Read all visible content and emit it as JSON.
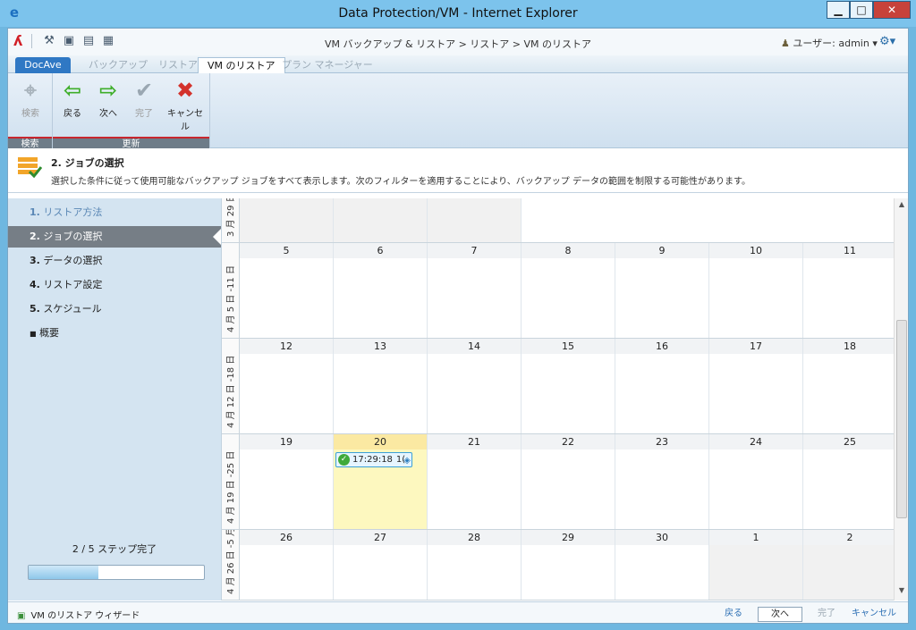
{
  "window": {
    "title": "Data Protection/VM - Internet Explorer"
  },
  "appbar": {
    "breadcrumb": "VM バックアップ & リストア > リストア > VM のリストア",
    "user": "ユーザー: admin ▾"
  },
  "tabs": [
    "DocAve",
    "バックアップ",
    "リストア",
    "VM のリストア",
    "プラン マネージャー"
  ],
  "ribbon": {
    "search_group": "検索",
    "update_group": "更新",
    "search": "検索",
    "back": "戻る",
    "next": "次へ",
    "finish": "完了",
    "cancel": "キャンセル"
  },
  "step_header": {
    "title": "2. ジョブの選択",
    "description": "選択した条件に従って使用可能なバックアップ ジョブをすべて表示します。次のフィルターを適用することにより、バックアップ データの範囲を制限する可能性があります。"
  },
  "steps": [
    {
      "num": "1.",
      "label": "リストア方法"
    },
    {
      "num": "2.",
      "label": "ジョブの選択"
    },
    {
      "num": "3.",
      "label": "データの選択"
    },
    {
      "num": "4.",
      "label": "リストア設定"
    },
    {
      "num": "5.",
      "label": "スケジュール"
    },
    {
      "num": "■",
      "label": "概要"
    }
  ],
  "progress": {
    "label": "2 / 5 ステップ完了",
    "fraction": 0.4
  },
  "calendar": {
    "weeks": [
      {
        "label": "3 月 29 日",
        "days": [
          "",
          "",
          "",
          "",
          "",
          "",
          ""
        ]
      },
      {
        "label": "4 月 5 日 -11 日",
        "days": [
          "5",
          "6",
          "7",
          "8",
          "9",
          "10",
          "11"
        ]
      },
      {
        "label": "4 月 12 日 -18 日",
        "days": [
          "12",
          "13",
          "14",
          "15",
          "16",
          "17",
          "18"
        ]
      },
      {
        "label": "4 月 19 日 -25 日",
        "days": [
          "19",
          "20",
          "21",
          "22",
          "23",
          "24",
          "25"
        ]
      },
      {
        "label": "4 月 26 日 -5 月 2 日",
        "days": [
          "26",
          "27",
          "28",
          "29",
          "30",
          "1",
          "2"
        ]
      }
    ],
    "event": {
      "time": "17:29:18",
      "extra": "1("
    }
  },
  "bottombar": {
    "wizard": "VM のリストア ウィザード",
    "back": "戻る",
    "next": "次へ",
    "finish": "完了",
    "cancel": "キャンセル"
  }
}
